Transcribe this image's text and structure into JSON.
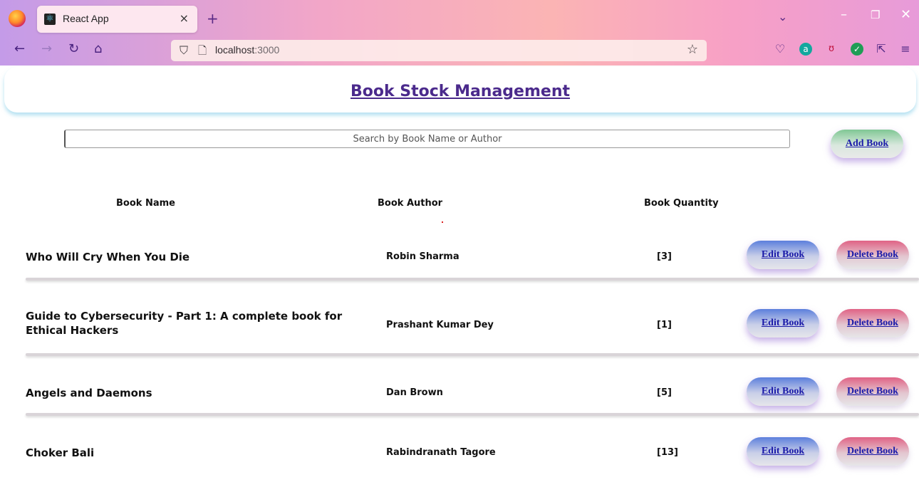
{
  "browser": {
    "tab_title": "React App",
    "tab_close": "×",
    "new_tab": "+",
    "url_host": "localhost",
    "url_port": ":3000"
  },
  "page": {
    "title": "Book Stock Management",
    "search_placeholder": "Search by Book Name or Author",
    "add_button": "Add Book"
  },
  "table": {
    "headers": [
      "Book Name",
      "Book Author",
      "Book Quantity"
    ],
    "edit_label": "Edit Book",
    "delete_label": "Delete Book",
    "rows": [
      {
        "name": "Who Will Cry When You Die",
        "author": "Robin Sharma",
        "quantity": "[3]"
      },
      {
        "name": "Guide to Cybersecurity - Part 1: A complete book for Ethical Hackers",
        "author": "Prashant Kumar Dey",
        "quantity": "[1]"
      },
      {
        "name": "Angels and Daemons",
        "author": "Dan Brown",
        "quantity": "[5]"
      },
      {
        "name": "Choker Bali",
        "author": "Rabindranath Tagore",
        "quantity": "[13]"
      }
    ]
  },
  "colors": {
    "title": "#4b2a8c",
    "button_text": "#1a1aa8",
    "add_button": "#7fc794",
    "edit_button": "#5b7fdc",
    "delete_button": "#e06285"
  }
}
